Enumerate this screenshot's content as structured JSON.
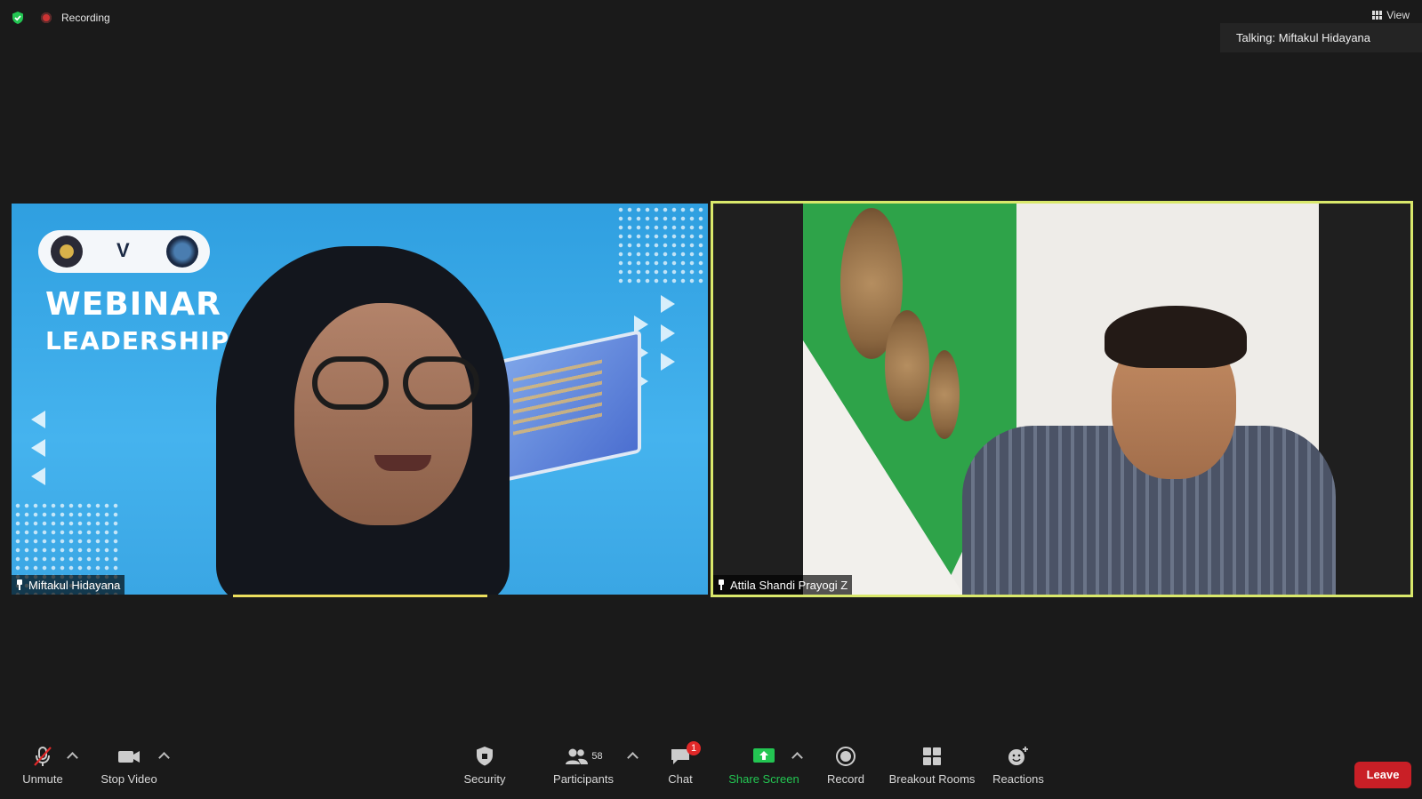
{
  "top": {
    "recording_label": "Recording",
    "view_label": "View",
    "talking_label": "Talking: Miftakul Hidayana"
  },
  "tiles": [
    {
      "name": "Miftakul Hidayana",
      "slide": {
        "title_line1": "WEBINAR",
        "title_line2": "LEADERSHIP & IT",
        "logo_text": "V"
      }
    },
    {
      "name": "Attila Shandi Prayogi Z",
      "active_speaker": true
    }
  ],
  "toolbar": {
    "unmute": "Unmute",
    "stop_video": "Stop Video",
    "security": "Security",
    "participants": "Participants",
    "participants_count": "58",
    "chat": "Chat",
    "chat_badge": "1",
    "share_screen": "Share Screen",
    "record": "Record",
    "breakout_rooms": "Breakout Rooms",
    "reactions": "Reactions",
    "leave": "Leave"
  },
  "colors": {
    "background": "#1a1a1a",
    "active_border": "#d9e86b",
    "share_green": "#23c552",
    "leave_red": "#c91f26",
    "badge_red": "#e02828"
  },
  "icons": [
    "shield-check-icon",
    "recording-icon",
    "grid-view-icon",
    "pin-icon",
    "mic-muted-icon",
    "video-camera-icon",
    "security-shield-icon",
    "participants-icon",
    "chat-bubble-icon",
    "share-screen-icon",
    "record-icon",
    "breakout-rooms-icon",
    "reactions-icon"
  ]
}
